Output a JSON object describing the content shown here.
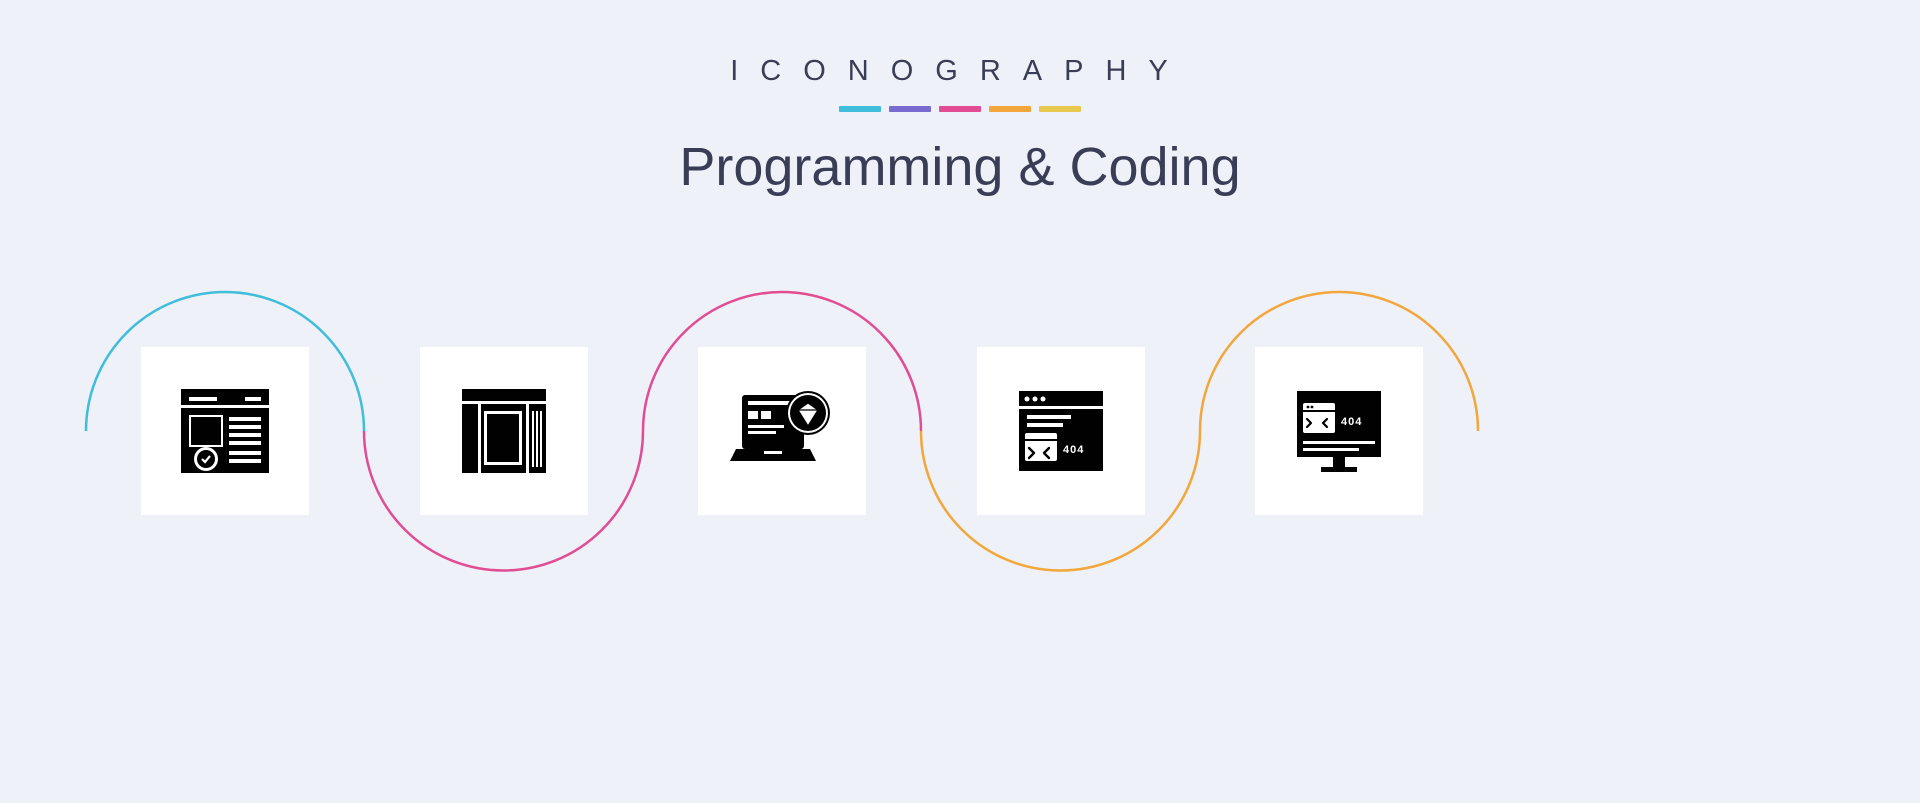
{
  "header": {
    "brand": "ICONOGRAPHY",
    "title": "Programming & Coding"
  },
  "accent_colors": {
    "cyan": "#3fbdda",
    "purple": "#7a6bd0",
    "pink": "#e14c93",
    "orange": "#f2a63b",
    "yellow": "#e8c84f"
  },
  "icons": [
    {
      "name": "web-page-approved-icon",
      "label": ""
    },
    {
      "name": "layout-wireframe-icon",
      "label": ""
    },
    {
      "name": "laptop-premium-diamond-icon",
      "label": ""
    },
    {
      "name": "browser-404-error-icon",
      "label": "404"
    },
    {
      "name": "monitor-404-error-icon",
      "label": "404"
    }
  ],
  "arcs": [
    {
      "color": "#3fbdda",
      "direction": "upper"
    },
    {
      "color": "#e14c93",
      "direction": "lower"
    },
    {
      "color": "#e14c93",
      "direction": "upper"
    },
    {
      "color": "#f2a63b",
      "direction": "lower"
    },
    {
      "color": "#f2a63b",
      "direction": "upper"
    }
  ]
}
